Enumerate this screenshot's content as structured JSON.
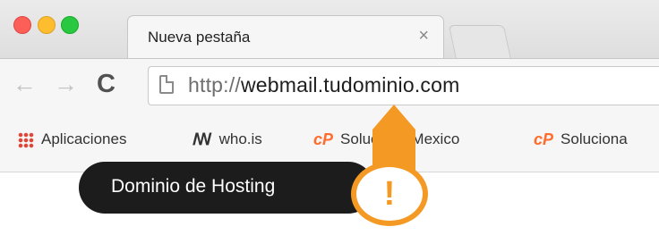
{
  "browser": {
    "tab": {
      "title": "Nueva pestaña",
      "close_glyph": "×"
    },
    "nav": {
      "back_glyph": "←",
      "forward_glyph": "→",
      "reload_glyph": "C"
    },
    "omnibox": {
      "scheme": "http://",
      "host": "webmail.tudominio.com"
    },
    "bookmarks": [
      {
        "icon": "apps-grid-icon",
        "label": "Aplicaciones"
      },
      {
        "icon": "whois-icon",
        "icon_text": "ꟿ",
        "label": "who.is"
      },
      {
        "icon": "cpanel-icon",
        "icon_text": "cP",
        "label": "Soluciona Mexico"
      },
      {
        "icon": "cpanel-icon",
        "icon_text": "cP",
        "label": "Soluciona"
      }
    ]
  },
  "callout": {
    "text": "Dominio de Hosting",
    "badge_glyph": "!",
    "accent_color": "#f49a24"
  }
}
